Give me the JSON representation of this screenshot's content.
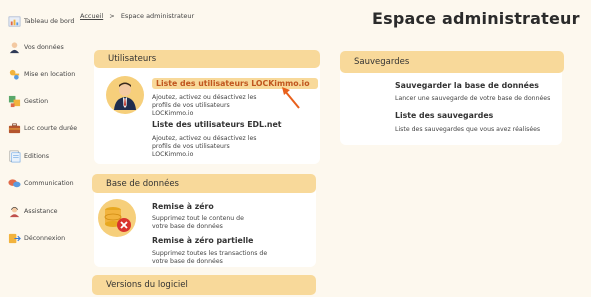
{
  "sidebar": {
    "items": [
      {
        "label": "Tableau de bord",
        "icon": "dashboard-icon"
      },
      {
        "label": "Vos données",
        "icon": "user-data-icon"
      },
      {
        "label": "Mise en location",
        "icon": "keys-icon"
      },
      {
        "label": "Gestion",
        "icon": "management-icon"
      },
      {
        "label": "Loc courte durée",
        "icon": "suitcase-icon"
      },
      {
        "label": "Editions",
        "icon": "documents-icon"
      },
      {
        "label": "Communication",
        "icon": "chat-bubbles-icon"
      },
      {
        "label": "Assistance",
        "icon": "support-agent-icon"
      },
      {
        "label": "Déconnexion",
        "icon": "logout-icon"
      }
    ]
  },
  "breadcrumb": {
    "home": "Accueil",
    "separator": ">",
    "current": "Espace administrateur"
  },
  "page_title": "Espace administrateur",
  "users_card": {
    "header": "Utilisateurs",
    "items": [
      {
        "title": "Liste des utilisateurs LOCKimmo.io",
        "desc": "Ajoutez, activez ou désactivez les profils de vos utilisateurs LOCKimmo.io"
      },
      {
        "title": "Liste des utilisateurs EDL.net",
        "desc": "Ajoutez, activez ou désactivez les profils de vos utilisateurs LOCKimmo.io"
      }
    ]
  },
  "database_card": {
    "header": "Base de données",
    "items": [
      {
        "title": "Remise à zéro",
        "desc": "Supprimez tout le contenu de votre base de données"
      },
      {
        "title": "Remise à zéro partielle",
        "desc": "Supprimez toutes les transactions de votre base de données"
      }
    ]
  },
  "versions_card": {
    "header": "Versions du logiciel"
  },
  "backups_card": {
    "header": "Sauvegardes",
    "items": [
      {
        "title": "Sauvegarder la base de données",
        "desc": "Lancer une sauvegarde de votre base de données"
      },
      {
        "title": "Liste des sauvegardes",
        "desc": "Liste des sauvegardes que vous avez réalisées"
      }
    ]
  },
  "colors": {
    "accent": "#f8d99a",
    "arrow": "#e8601c",
    "background": "#fdf8ee"
  }
}
